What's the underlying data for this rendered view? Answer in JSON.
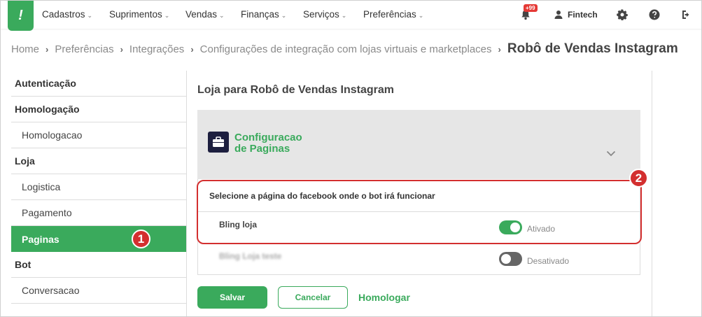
{
  "nav": {
    "items": [
      {
        "label": "Cadastros"
      },
      {
        "label": "Suprimentos"
      },
      {
        "label": "Vendas"
      },
      {
        "label": "Finanças"
      },
      {
        "label": "Serviços"
      },
      {
        "label": "Preferências"
      }
    ],
    "notification_badge": "+99",
    "user_name": "Fintech",
    "icons": [
      "bell-icon",
      "user-icon",
      "gear-icon",
      "help-icon",
      "logout-icon"
    ]
  },
  "breadcrumb": {
    "items": [
      "Home",
      "Preferências",
      "Integrações",
      "Configurações de integração com lojas virtuais e marketplaces"
    ],
    "current": "Robô de Vendas Instagram"
  },
  "sidebar": {
    "items": [
      {
        "label": "Autenticação",
        "type": "header"
      },
      {
        "label": "Homologação",
        "type": "header"
      },
      {
        "label": "Homologacao",
        "type": "sub"
      },
      {
        "label": "Loja",
        "type": "header"
      },
      {
        "label": "Logistica",
        "type": "sub"
      },
      {
        "label": "Pagamento",
        "type": "sub"
      },
      {
        "label": "Paginas",
        "type": "sub",
        "active": true
      },
      {
        "label": "Bot",
        "type": "header"
      },
      {
        "label": "Conversacao",
        "type": "sub"
      }
    ]
  },
  "main": {
    "title": "Loja para Robô de Vendas Instagram",
    "panel_title": "Configuracao de Paginas",
    "list_header": "Selecione a página do facebook onde o bot irá funcionar",
    "pages": [
      {
        "name": "Bling loja",
        "status": "Ativado",
        "enabled": true
      },
      {
        "name": "Bling Loja teste",
        "status": "Desativado",
        "enabled": false
      }
    ]
  },
  "buttons": {
    "save": "Salvar",
    "cancel": "Cancelar",
    "homologar": "Homologar"
  },
  "markers": {
    "one": "1",
    "two": "2"
  },
  "colors": {
    "brand_green": "#3aaa5c",
    "marker_red": "#d32f2f",
    "panel_gray": "#e6e6e6",
    "briefcase_navy": "#1d1f3f"
  }
}
